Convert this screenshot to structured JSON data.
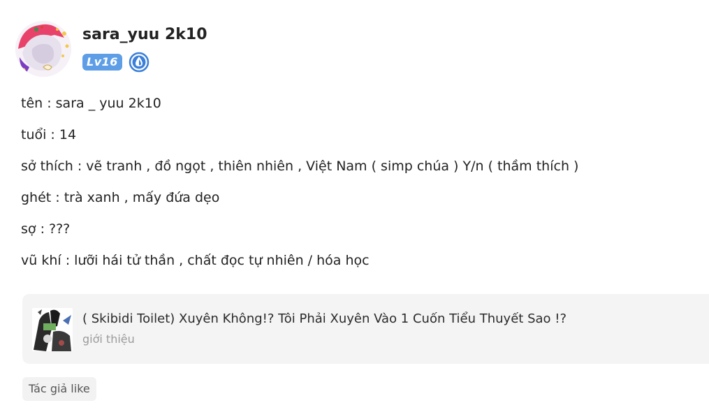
{
  "profile": {
    "username": "sara_yuu 2k10",
    "level_badge": "Lv16",
    "vip_icon": "droplet-crest-icon",
    "avatar_icon": "anime-avatar-icon"
  },
  "bio": {
    "lines": [
      "tên : sara _ yuu 2k10",
      "tuổi : 14",
      "sở thích : vẽ tranh , đồ ngọt , thiên nhiên , Việt Nam ( simp chúa ) Y/n ( thầm thích )",
      "ghét : trà xanh , mấy đứa dẹo",
      "sợ : ???",
      "vũ khí : lưỡi hái tử thần , chất đọc tự nhiên / hóa học"
    ]
  },
  "story": {
    "title": "( Skibidi Toilet) Xuyên Không!? Tôi Phải Xuyên Vào 1 Cuốn Tiểu Thuyết Sao !?",
    "subtitle": "giới thiệu",
    "cover_icon": "story-cover-image"
  },
  "like_tag": {
    "label": "Tác giả like"
  },
  "colors": {
    "level_badge_bg": "#5e9ee6",
    "vip_badge": "#3a7fd9",
    "card_bg": "#f4f4f4",
    "tag_bg": "#f2f2f2",
    "muted_text": "#9b9b9b"
  }
}
